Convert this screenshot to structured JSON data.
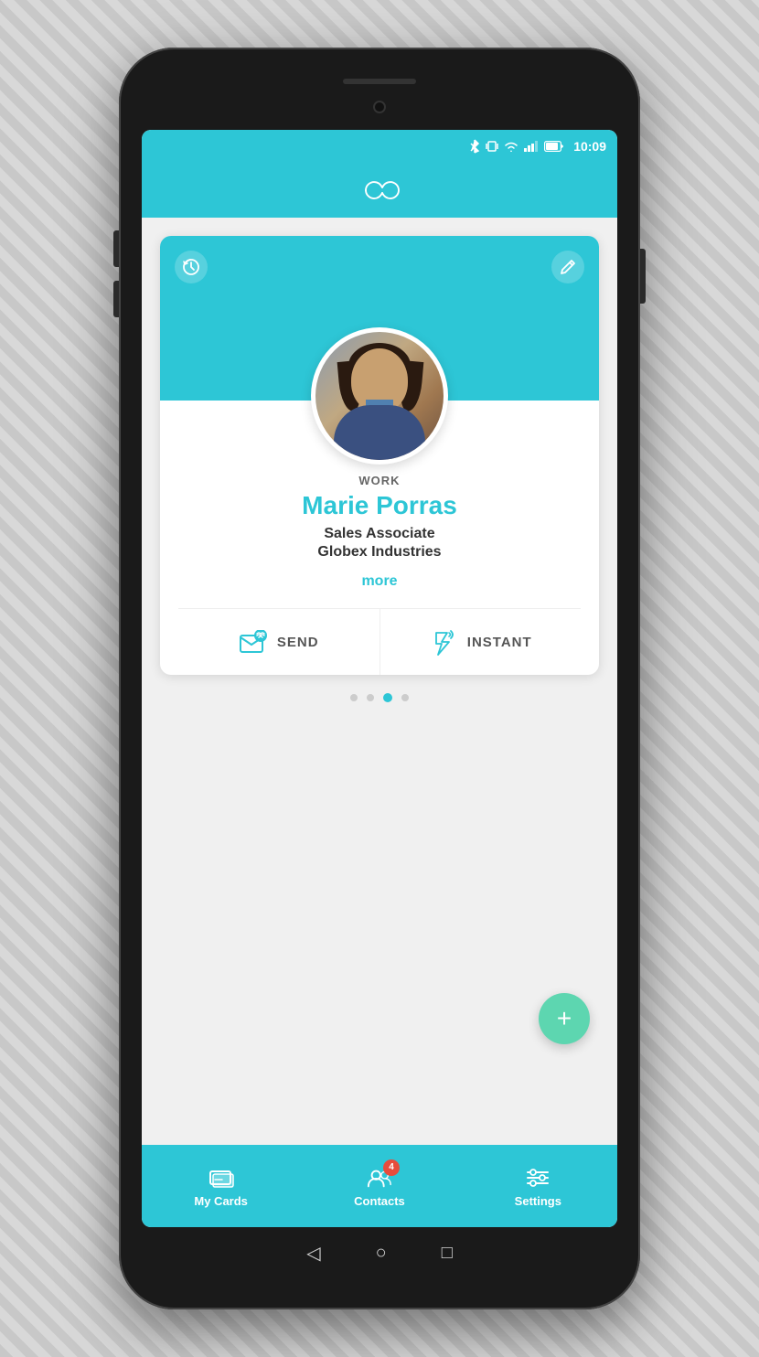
{
  "statusBar": {
    "time": "10:09",
    "icons": [
      "bluetooth",
      "vibrate",
      "wifi",
      "signal",
      "battery"
    ]
  },
  "header": {
    "logo": "infinity"
  },
  "card": {
    "typeLabel": "WORK",
    "name": "Marie Porras",
    "jobTitle": "Sales Associate",
    "company": "Globex Industries",
    "moreLink": "more",
    "actions": {
      "send": "SEND",
      "instant": "INSTANT"
    }
  },
  "pageIndicators": {
    "total": 4,
    "active": 2
  },
  "fab": {
    "label": "+"
  },
  "bottomNav": {
    "items": [
      {
        "id": "my-cards",
        "label": "My Cards",
        "icon": "cards"
      },
      {
        "id": "contacts",
        "label": "Contacts",
        "icon": "contacts",
        "badge": "4"
      },
      {
        "id": "settings",
        "label": "Settings",
        "icon": "settings"
      }
    ]
  },
  "androidNav": {
    "back": "◁",
    "home": "○",
    "recent": "□"
  }
}
